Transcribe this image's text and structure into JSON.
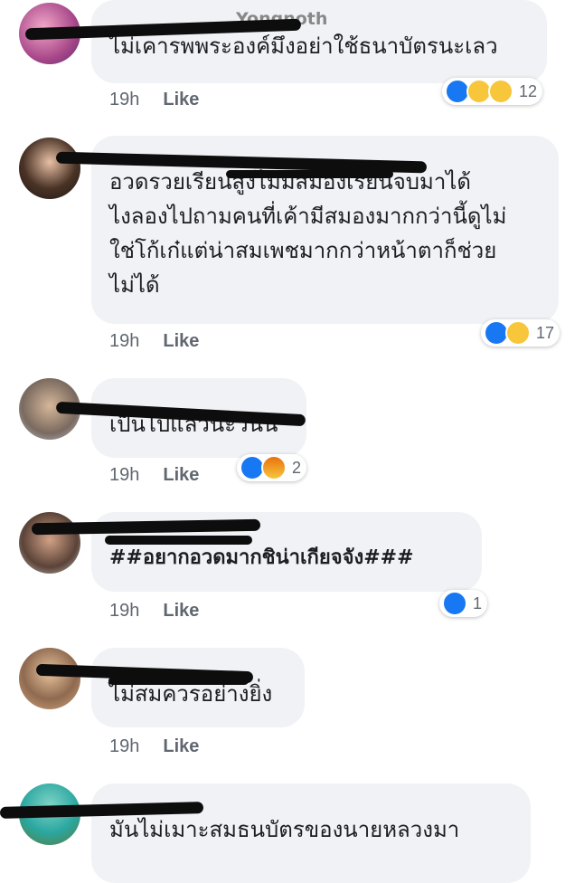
{
  "comments": [
    {
      "author": "Yongnoth",
      "text": "ไม่เคารพพระองค์มึงอย่าใช้ธนาบัตรนะเลว",
      "time": "19h",
      "like_label": "Like",
      "reactions": [
        "like-icon",
        "haha-icon",
        "wow-icon"
      ],
      "reaction_count": "12"
    },
    {
      "author": "",
      "text": "อวดรวยเรียนสูงไม่มีสมองเรียนจบมาได้\nไงลองไปถามคนที่เค้ามีสมองมากกว่านี้ดูไม่\nใช่โก้เก๋แต่น่าสมเพชมากกว่าหน้าตาก็ช่วย\nไม่ได้",
      "time": "19h",
      "like_label": "Like",
      "reactions": [
        "like-icon",
        "haha-icon"
      ],
      "reaction_count": "17"
    },
    {
      "author": "",
      "text": "เป็นไปแล้วน่ะวันนี",
      "time": "19h",
      "like_label": "Like",
      "reactions": [
        "like-icon",
        "angry-icon"
      ],
      "reaction_count": "2"
    },
    {
      "author": "",
      "text": "##อยากอวดมากชิน่าเกียจจัง###",
      "time": "19h",
      "like_label": "Like",
      "reactions": [
        "like-icon"
      ],
      "reaction_count": "1"
    },
    {
      "author": "",
      "text": "ไม่สมควรอย่างยิ่ง",
      "time": "19h",
      "like_label": "Like",
      "reactions": [],
      "reaction_count": ""
    },
    {
      "author": "",
      "text": "มันไม่เมาะสมธนบัตรของนายหลวงมา",
      "time": "",
      "like_label": "",
      "reactions": [],
      "reaction_count": ""
    }
  ],
  "colors": {
    "bubble": "#f0f2f5",
    "like_blue": "#1877f2",
    "emoji_yellow": "#f7c63b",
    "meta_gray": "#606770",
    "redaction": "#0d0d0d"
  }
}
